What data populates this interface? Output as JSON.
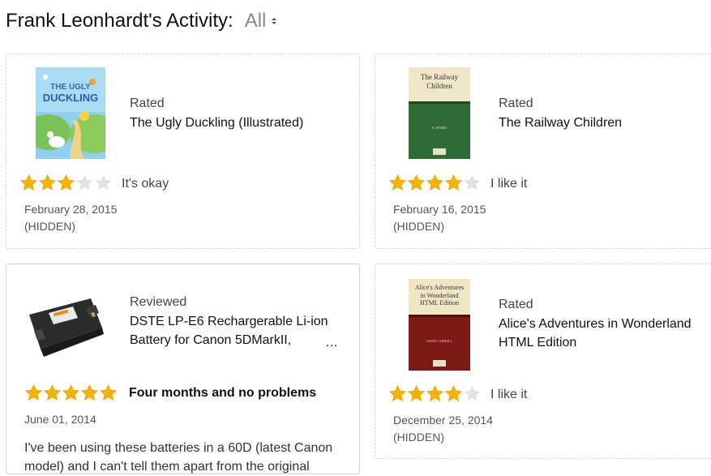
{
  "header": {
    "title": "Frank Leonhardt's Activity:",
    "filter_value": "All"
  },
  "colors": {
    "star_filled": "#f5b300",
    "star_empty": "#e2e2e2",
    "border": "#d6d6d6"
  },
  "cards": [
    {
      "action": "Rated",
      "title": "The Ugly Duckling (Illustrated)",
      "rating": 3,
      "rating_text": "It's okay",
      "date": "February 28, 2015",
      "visibility": "(HIDDEN)",
      "thumb": {
        "cover_top": "THE UGLY",
        "cover_bottom": "DUCKLING"
      }
    },
    {
      "action": "Rated",
      "title": "The Railway Children",
      "rating": 4,
      "rating_text": "I like it",
      "date": "February 16, 2015",
      "visibility": "(HIDDEN)",
      "thumb": {
        "cover_title": "The Railway Children",
        "author": "E. NESBIT"
      }
    },
    {
      "action": "Reviewed",
      "title_line1": "DSTE LP-E6 Rechargerable Li-ion",
      "title_line2": "Battery for Canon 5DMarkII,",
      "ellipsis": "…",
      "rating": 5,
      "review_title": "Four months and no problems",
      "date": "June 01, 2014",
      "body_line1": "I've been using these batteries in a 60D (latest Canon",
      "body_line2": "model) and I can't tell them apart from the original"
    },
    {
      "action": "Rated",
      "title_line1": "Alice's Adventures in Wonderland",
      "title_line2": "HTML Edition",
      "rating": 4,
      "rating_text": "I like it",
      "date": "December 25, 2014",
      "visibility": "(HIDDEN)",
      "thumb": {
        "cover_title": "Alice's Adventures in Wonderland HTML Edition",
        "author": "LEWIS CARROLL"
      }
    }
  ]
}
